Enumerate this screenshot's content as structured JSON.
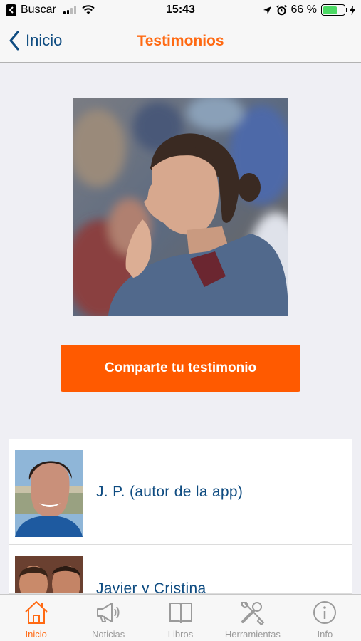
{
  "status_bar": {
    "back_app": "Buscar",
    "time": "15:43",
    "battery_percent": "66 %",
    "battery_level": 0.66,
    "battery_color": "#4cd964"
  },
  "nav": {
    "back_label": "Inicio",
    "title": "Testimonios",
    "accent_color": "#ff6a13",
    "link_color": "#0f4c81"
  },
  "share_button": {
    "label": "Comparte tu testimonio",
    "color": "#ff5a00"
  },
  "testimonials": [
    {
      "name": "J. P. (autor de la app)"
    },
    {
      "name": "Javier y Cristina"
    }
  ],
  "tabs": [
    {
      "label": "Inicio",
      "icon": "home-icon",
      "active": true
    },
    {
      "label": "Noticias",
      "icon": "megaphone-icon",
      "active": false
    },
    {
      "label": "Libros",
      "icon": "book-icon",
      "active": false
    },
    {
      "label": "Herramientas",
      "icon": "tools-icon",
      "active": false
    },
    {
      "label": "Info",
      "icon": "info-icon",
      "active": false
    }
  ]
}
